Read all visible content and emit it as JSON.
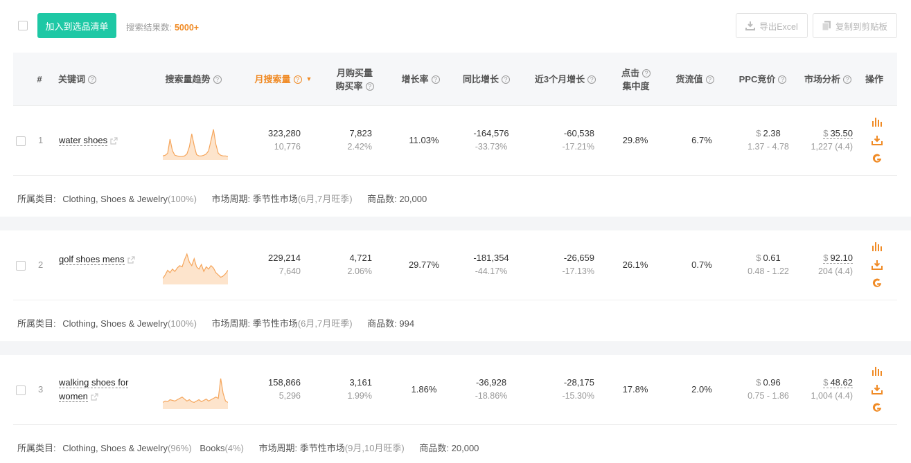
{
  "toolbar": {
    "add_button": "加入到选品清单",
    "results_label": "搜索结果数:",
    "results_count": "5000+",
    "export_excel": "导出Excel",
    "copy_clipboard": "复制到剪贴板"
  },
  "header": {
    "index": "#",
    "keyword": "关键词",
    "trend": "搜索量趋势",
    "monthly_search": "月搜索量",
    "purchase_line1": "月购买量",
    "purchase_line2": "购买率",
    "growth": "增长率",
    "yoy": "同比增长",
    "three_month": "近3个月增长",
    "click_line1": "点击",
    "click_line2": "集中度",
    "flow": "货流值",
    "ppc": "PPC竞价",
    "market": "市场分析",
    "ops": "操作"
  },
  "labels": {
    "category": "所属类目:",
    "cycle": "市场周期:",
    "products": "商品数:"
  },
  "rows": [
    {
      "index": "1",
      "keyword": "water shoes",
      "search": "323,280",
      "search_sub": "10,776",
      "purchase": "7,823",
      "purchase_rate": "2.42%",
      "growth": "11.03%",
      "yoy": "-164,576",
      "yoy_pct": "-33.73%",
      "three": "-60,538",
      "three_pct": "-17.21%",
      "click": "29.8%",
      "flow": "6.7%",
      "ppc_sym": "$",
      "ppc": "2.38",
      "ppc_range": "1.37 - 4.78",
      "market_sym": "$",
      "market": "35.50",
      "market_sub": "1,227 (4.4)",
      "cat1": "Clothing, Shoes & Jewelry",
      "cat1_pct": "(100%)",
      "cat2": "",
      "cat2_pct": "",
      "cycle": "季节性市场",
      "cycle_note": "(6月,7月旺季)",
      "products": "20,000",
      "trend": [
        4,
        5,
        8,
        30,
        12,
        5,
        4,
        3,
        3,
        4,
        7,
        18,
        38,
        20,
        6,
        4,
        4,
        5,
        7,
        12,
        28,
        45,
        22,
        8,
        5,
        4,
        4,
        3
      ]
    },
    {
      "index": "2",
      "keyword": "golf shoes mens",
      "search": "229,214",
      "search_sub": "7,640",
      "purchase": "4,721",
      "purchase_rate": "2.06%",
      "growth": "29.77%",
      "yoy": "-181,354",
      "yoy_pct": "-44.17%",
      "three": "-26,659",
      "three_pct": "-17.13%",
      "click": "26.1%",
      "flow": "0.7%",
      "ppc_sym": "$",
      "ppc": "0.61",
      "ppc_range": "0.48 - 1.22",
      "market_sym": "$",
      "market": "92.10",
      "market_sub": "204 (4.4)",
      "cat1": "Clothing, Shoes & Jewelry",
      "cat1_pct": "(100%)",
      "cat2": "",
      "cat2_pct": "",
      "cycle": "季节性市场",
      "cycle_note": "(6月,7月旺季)",
      "products": "994",
      "trend": [
        8,
        14,
        22,
        18,
        24,
        20,
        26,
        30,
        28,
        40,
        50,
        36,
        30,
        42,
        28,
        24,
        32,
        20,
        28,
        24,
        30,
        26,
        18,
        14,
        10,
        12,
        16,
        22
      ]
    },
    {
      "index": "3",
      "keyword": "walking shoes for women",
      "search": "158,866",
      "search_sub": "5,296",
      "purchase": "3,161",
      "purchase_rate": "1.99%",
      "growth": "1.86%",
      "yoy": "-36,928",
      "yoy_pct": "-18.86%",
      "three": "-28,175",
      "three_pct": "-15.30%",
      "click": "17.8%",
      "flow": "2.0%",
      "ppc_sym": "$",
      "ppc": "0.96",
      "ppc_range": "0.75 - 1.86",
      "market_sym": "$",
      "market": "48.62",
      "market_sub": "1,004 (4.4)",
      "cat1": "Clothing, Shoes & Jewelry",
      "cat1_pct": "(96%)",
      "cat2": "Books",
      "cat2_pct": "(4%)",
      "cycle": "季节性市场",
      "cycle_note": "(9月,10月旺季)",
      "products": "20,000",
      "trend": [
        8,
        10,
        9,
        12,
        11,
        10,
        12,
        14,
        16,
        13,
        10,
        12,
        9,
        8,
        10,
        12,
        9,
        11,
        13,
        10,
        12,
        14,
        16,
        14,
        44,
        22,
        10,
        8
      ]
    }
  ],
  "colors": {
    "accent": "#1ec8a5",
    "orange": "#f08a24",
    "trend_line": "#f5a55b",
    "trend_fill": "#fde4cc"
  }
}
